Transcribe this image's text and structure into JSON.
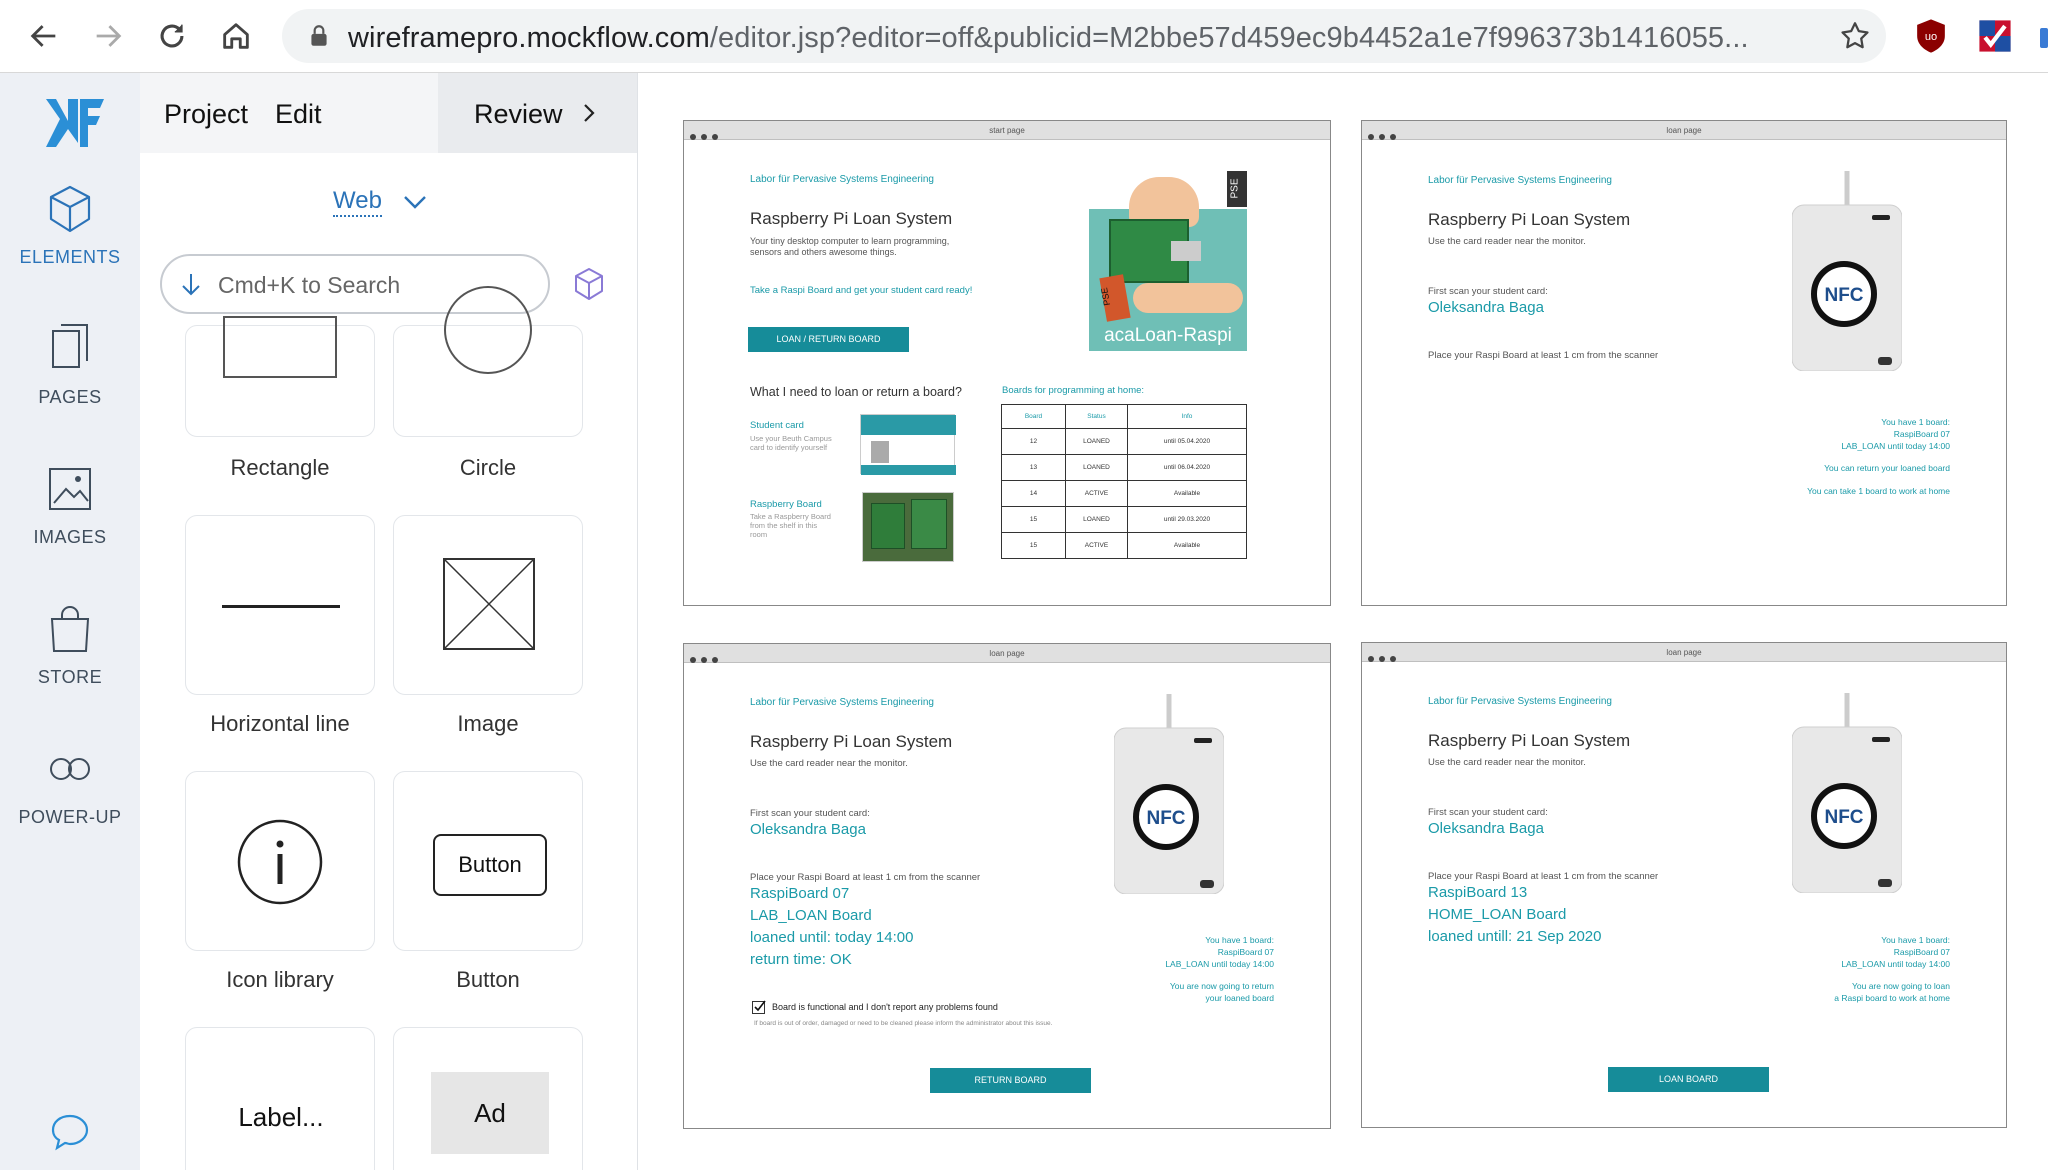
{
  "browser": {
    "url_host": "wireframepro.mockflow.com",
    "url_path": "/editor.jsp?editor=off&publicid=M2bbe57d459ec9b4452a1e7f996373b1416055..."
  },
  "rail": {
    "items": [
      {
        "label": "ELEMENTS",
        "icon": "cube-icon"
      },
      {
        "label": "PAGES",
        "icon": "pages-icon"
      },
      {
        "label": "IMAGES",
        "icon": "image-icon"
      },
      {
        "label": "STORE",
        "icon": "bag-icon"
      },
      {
        "label": "POWER-UP",
        "icon": "infinity-icon"
      }
    ]
  },
  "panel": {
    "menu": {
      "project": "Project",
      "edit": "Edit",
      "review": "Review"
    },
    "platform": "Web",
    "search_placeholder": "Cmd+K to Search",
    "tiles": [
      {
        "label": "Rectangle"
      },
      {
        "label": "Circle"
      },
      {
        "label": "Horizontal line"
      },
      {
        "label": "Image"
      },
      {
        "label": "Icon library"
      },
      {
        "label": "Button"
      },
      {
        "label": "",
        "preview": "Label..."
      },
      {
        "label": "",
        "preview": "Ad"
      }
    ],
    "button_preview": "Button"
  },
  "frames": {
    "start": {
      "title": "start page",
      "lab": "Labor für Pervasive Systems Engineering",
      "heading": "Raspberry Pi Loan System",
      "desc1": "Your tiny desktop computer to learn programming,",
      "desc2": "sensors and others awesome things.",
      "cta": "Take a Raspi Board and get your student card ready!",
      "button": "LOAN / RETURN BOARD",
      "question": "What I need to loan or return a board?",
      "card_title": "Student card",
      "card_desc1": "Use your Beuth Campus",
      "card_desc2": "card to identify yourself",
      "board_title": "Raspberry Board",
      "board_desc1": "Take a Raspberry Board",
      "board_desc2": "from the shelf in this",
      "board_desc3": "room",
      "home_title": "Boards for programming at home:",
      "image_text": "acaLoan-Raspi",
      "image_badge": "PSE",
      "image_tag": "Studi",
      "table": {
        "headers": [
          "Board",
          "Status",
          "Info"
        ],
        "rows": [
          [
            "12",
            "LOANED",
            "until 05.04.2020"
          ],
          [
            "13",
            "LOANED",
            "until 06.04.2020"
          ],
          [
            "14",
            "ACTIVE",
            "Available"
          ],
          [
            "15",
            "LOANED",
            "until 29.03.2020"
          ],
          [
            "15",
            "ACTIVE",
            "Available"
          ]
        ]
      }
    },
    "loan1": {
      "title": "loan page",
      "lab": "Labor für Pervasive Systems Engineering",
      "heading": "Raspberry Pi Loan System",
      "use_reader": "Use the card reader near the monitor.",
      "scan_card": "First scan your student card:",
      "student": "Oleksandra Baga",
      "place": "Place your Raspi Board at least 1 cm from the scanner",
      "info1": "You have 1 board:",
      "info2": "RaspiBoard 07",
      "info3": "LAB_LOAN until today 14:00",
      "info4": "You can return your loaned board",
      "info5": "You can take 1 board to work at home"
    },
    "loan2": {
      "title": "loan page",
      "lab": "Labor für Pervasive Systems Engineering",
      "heading": "Raspberry Pi Loan System",
      "use_reader": "Use the card reader near the monitor.",
      "scan_card": "First scan your student card:",
      "student": "Oleksandra Baga",
      "place": "Place your Raspi Board at least 1 cm from the scanner",
      "board": "RaspiBoard 07",
      "loan_type": "LAB_LOAN Board",
      "loaned_until": "loaned until: today 14:00",
      "return_time": "return time: OK",
      "info1": "You have 1 board:",
      "info2": "RaspiBoard 07",
      "info3": "LAB_LOAN until today 14:00",
      "info4": "You are now going to return",
      "info5": "your loaned board",
      "checkbox": "Board is functional and I don't report any problems found",
      "note": "If board is out of order, damaged or need to be cleaned please inform the administrator about this issue.",
      "button": "RETURN BOARD"
    },
    "loan3": {
      "title": "loan page",
      "lab": "Labor für Pervasive Systems Engineering",
      "heading": "Raspberry Pi Loan System",
      "use_reader": "Use the card reader near the monitor.",
      "scan_card": "First scan your student card:",
      "student": "Oleksandra Baga",
      "place": "Place your Raspi Board at least 1 cm from the scanner",
      "board": "RaspiBoard 13",
      "loan_type": "HOME_LOAN Board",
      "loaned_until": "loaned untill: 21 Sep 2020",
      "info1": "You have 1 board:",
      "info2": "RaspiBoard 07",
      "info3": "LAB_LOAN until today 14:00",
      "info4": "You are now going to loan",
      "info5": "a Raspi board to work at home",
      "button": "LOAN BOARD"
    }
  },
  "colors": {
    "accent": "#2b73b8",
    "teal": "#168c99",
    "rail_bg": "#edf0f5"
  }
}
